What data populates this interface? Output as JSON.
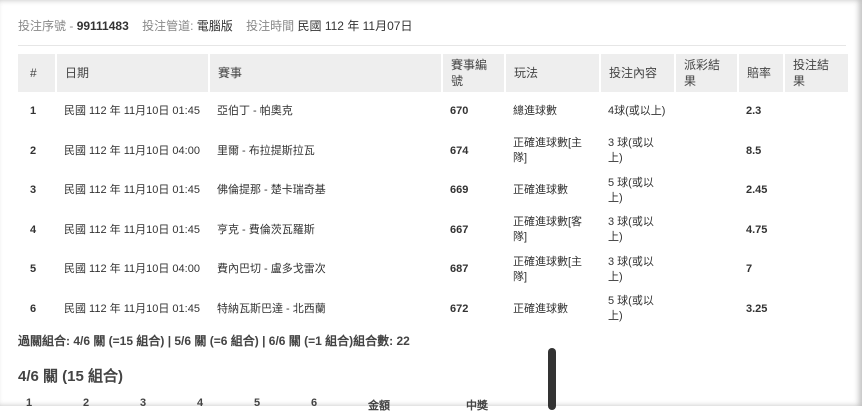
{
  "header": {
    "serial_label": "投注序號 -",
    "serial_value": "99111483",
    "channel_label": "投注管道:",
    "channel_value": "電腦版",
    "time_label": "投注時間",
    "time_value": "民國 112 年 11月07日"
  },
  "table": {
    "headers": [
      "#",
      "日期",
      "賽事",
      "賽事編號",
      "玩法",
      "投注內容",
      "派彩結果",
      "賠率",
      "投注結果"
    ],
    "rows": [
      {
        "no": "1",
        "date": "民國 112 年 11月10日 01:45",
        "match": "亞伯丁 - 帕奧克",
        "code": "670",
        "play": "總進球數",
        "content": "4球(或以上)",
        "payout": "",
        "odds": "2.3",
        "result": ""
      },
      {
        "no": "2",
        "date": "民國 112 年 11月10日 04:00",
        "match": "里爾 - 布拉提斯拉瓦",
        "code": "674",
        "play": "正確進球數[主隊]",
        "content": "3 球(或以上)",
        "payout": "",
        "odds": "8.5",
        "result": ""
      },
      {
        "no": "3",
        "date": "民國 112 年 11月10日 01:45",
        "match": "佛倫提那 - 楚卡瑞奇基",
        "code": "669",
        "play": "正確進球數",
        "content": "5 球(或以上)",
        "payout": "",
        "odds": "2.45",
        "result": ""
      },
      {
        "no": "4",
        "date": "民國 112 年 11月10日 01:45",
        "match": "亨克 - 費倫茨瓦羅斯",
        "code": "667",
        "play": "正確進球數[客隊]",
        "content": "3 球(或以上)",
        "payout": "",
        "odds": "4.75",
        "result": ""
      },
      {
        "no": "5",
        "date": "民國 112 年 11月10日 04:00",
        "match": "費內巴切 - 盧多戈雷次",
        "code": "687",
        "play": "正確進球數[主隊]",
        "content": "3 球(或以上)",
        "payout": "",
        "odds": "7",
        "result": ""
      },
      {
        "no": "6",
        "date": "民國 112 年 11月10日 01:45",
        "match": "特納瓦斯巴達 - 北西蘭",
        "code": "672",
        "play": "正確進球數",
        "content": "5 球(或以上)",
        "payout": "",
        "odds": "3.25",
        "result": ""
      }
    ]
  },
  "summary": "過關組合: 4/6 關 (=15 組合) | 5/6 關 (=6 組合) | 6/6 關 (=1 組合)組合數: 22",
  "section_title": "4/6 關 (15 組合)",
  "combo_headers": [
    "1",
    "2",
    "3",
    "4",
    "5",
    "6",
    "金額",
    "中獎"
  ]
}
